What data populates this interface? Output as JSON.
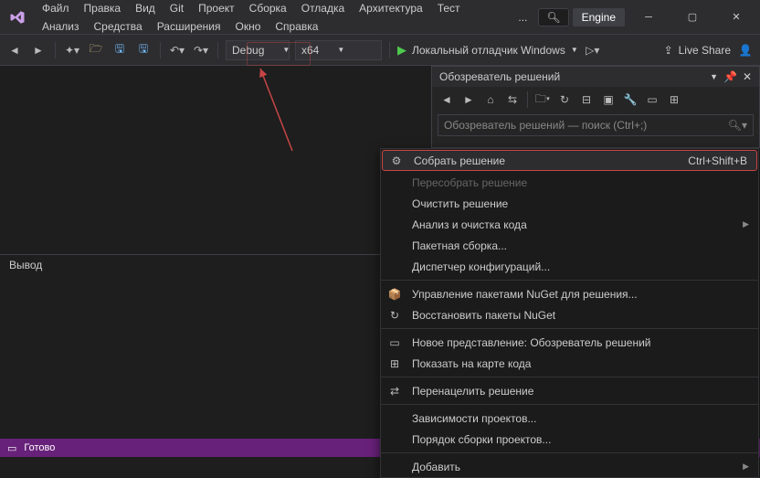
{
  "menu": [
    "Файл",
    "Правка",
    "Вид",
    "Git",
    "Проект",
    "Сборка",
    "Отладка",
    "Архитектура",
    "Тест",
    "Анализ",
    "Средства",
    "Расширения",
    "Окно",
    "Справка"
  ],
  "engine": "Engine",
  "config": "Debug",
  "platform": "x64",
  "startdbg": "Локальный отладчик Windows",
  "liveshare": "Live Share",
  "sol_title": "Обозреватель решений",
  "sol_search": "Обозреватель решений — поиск (Ctrl+;)",
  "output": "Вывод",
  "status": "Готово",
  "ctx": [
    {
      "icon": "⚙",
      "label": "Собрать решение",
      "short": "Ctrl+Shift+B",
      "hl": true
    },
    {
      "label": "Пересобрать решение",
      "disabled": true
    },
    {
      "label": "Очистить решение"
    },
    {
      "label": "Анализ и очистка кода",
      "arrow": true
    },
    {
      "label": "Пакетная сборка..."
    },
    {
      "label": "Диспетчер конфигураций..."
    },
    {
      "sep": true
    },
    {
      "icon": "📦",
      "label": "Управление пакетами NuGet для решения..."
    },
    {
      "icon": "↻",
      "label": "Восстановить пакеты NuGet"
    },
    {
      "sep": true
    },
    {
      "icon": "▭",
      "label": "Новое представление: Обозреватель решений"
    },
    {
      "icon": "⊞",
      "label": "Показать на карте кода"
    },
    {
      "sep": true
    },
    {
      "icon": "⇄",
      "label": "Перенацелить решение"
    },
    {
      "sep": true
    },
    {
      "label": "Зависимости проектов..."
    },
    {
      "label": "Порядок сборки проектов..."
    },
    {
      "sep": true
    },
    {
      "label": "Добавить",
      "arrow": true
    }
  ]
}
